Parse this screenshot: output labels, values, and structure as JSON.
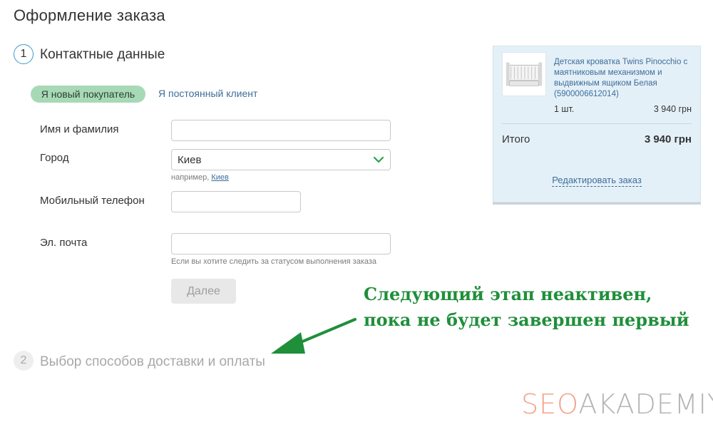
{
  "page": {
    "title": "Оформление заказа"
  },
  "steps": [
    {
      "number": "1",
      "label": "Контактные данные",
      "state": "active"
    },
    {
      "number": "2",
      "label": "Выбор способов доставки и оплаты",
      "state": "inactive"
    }
  ],
  "customer_tabs": {
    "new_label": "Я новый покупатель",
    "regular_label": "Я постоянный клиент",
    "selected": "new"
  },
  "form": {
    "name_label": "Имя и фамилия",
    "name_value": "",
    "city_label": "Город",
    "city_value": "Киев",
    "city_hint_prefix": "например,",
    "city_hint_link": "Киев",
    "phone_label": "Мобильный телефон",
    "phone_value": "",
    "email_label": "Эл. почта",
    "email_value": "",
    "email_hint": "Если вы хотите следить за статусом выполнения заказа",
    "next_button": "Далее"
  },
  "cart": {
    "product_name": "Детская кроватка Twins Pinocchio с маятниковым механизмом и выдвижным ящиком Белая (5900006612014)",
    "quantity": "1 шт.",
    "line_price": "3 940 грн",
    "total_label": "Итого",
    "total_value": "3 940 грн",
    "edit_link": "Редактировать заказ"
  },
  "annotation": {
    "line1": "Следующий этап неактивен,",
    "line2": "пока не будет завершен первый"
  },
  "watermark": {
    "part1": "SEO",
    "part2": "AKADEMIYA"
  },
  "colors": {
    "accent_green": "#a7d9b6",
    "link_blue": "#3e6e99",
    "annotation_green": "#1f8f3a",
    "cart_bg": "#e4f0f8"
  },
  "icons": {
    "select_arrow": "chevron-down-icon",
    "annotation_arrow": "arrow-icon"
  }
}
